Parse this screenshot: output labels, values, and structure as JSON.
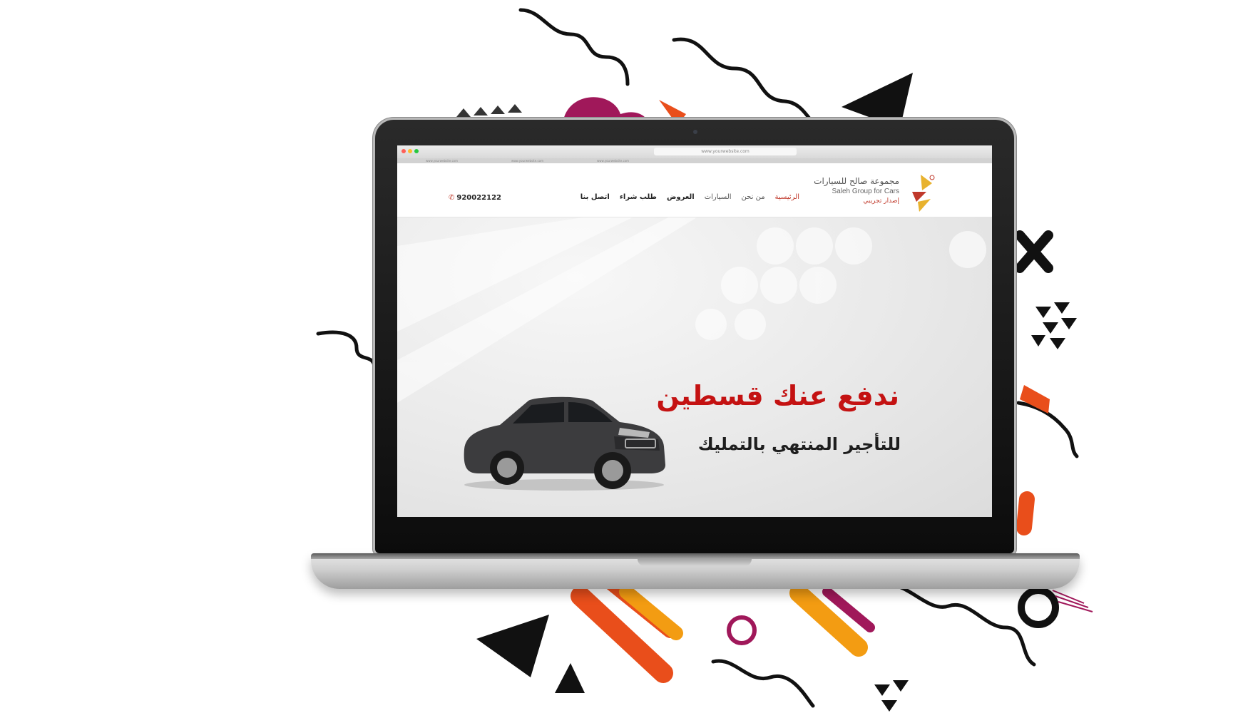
{
  "browser": {
    "url": "www.yourwebsite.com",
    "tabs": [
      "www.yourwebsite.com",
      "www.yourwebsite.com",
      "www.yourwebsite.com"
    ]
  },
  "header": {
    "logo_ar": "مجموعة صالح للسيارات",
    "logo_en": "Saleh Group for Cars",
    "logo_version": "إصدار تجريبي",
    "phone": "920022122"
  },
  "nav": {
    "items": [
      {
        "label": "الرئيسية",
        "active": true
      },
      {
        "label": "من نحن"
      },
      {
        "label": "السيارات"
      },
      {
        "label": "العروض"
      },
      {
        "label": "طلب شراء"
      },
      {
        "label": "اتصل بنا"
      }
    ]
  },
  "hero": {
    "title": "ندفع عنك قسطين",
    "subtitle": "للتأجير المنتهي بالتمليك"
  },
  "colors": {
    "brand_red": "#c41212",
    "nav_active": "#c0392b",
    "logo_gold": "#e8b22e",
    "decor_magenta": "#a0185a",
    "decor_orange": "#e94e1b",
    "decor_yellow": "#f39c12"
  },
  "icons": {
    "phone": "phone-icon",
    "logo": "logo-mark-icon"
  }
}
